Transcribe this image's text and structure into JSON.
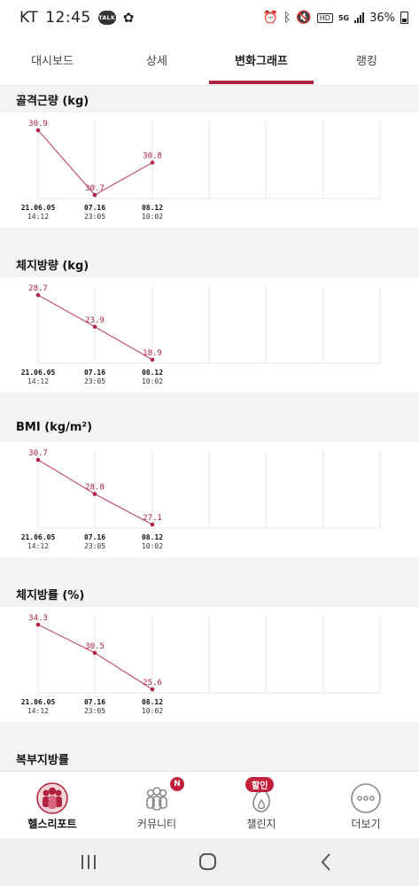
{
  "status_bar": {
    "carrier": "KT",
    "time": "12:45",
    "talk": "TALK",
    "network": "5G",
    "battery": "36%"
  },
  "tabs": [
    {
      "label": "대시보드"
    },
    {
      "label": "상세"
    },
    {
      "label": "변화그래프"
    },
    {
      "label": "랭킹"
    }
  ],
  "active_tab_index": 2,
  "chart_data": [
    {
      "type": "line",
      "title": "골격근량 (kg)",
      "x": [
        "21.06.05 14:12",
        "07.16 23:05",
        "08.12 10:02"
      ],
      "series": [
        {
          "values": [
            30.9,
            30.7,
            30.8
          ]
        }
      ],
      "grid": true
    },
    {
      "type": "line",
      "title": "체지방량 (kg)",
      "x": [
        "21.06.05 14:12",
        "07.16 23:05",
        "08.12 10:02"
      ],
      "series": [
        {
          "values": [
            28.7,
            23.9,
            18.9
          ]
        }
      ],
      "grid": true
    },
    {
      "type": "line",
      "title": "BMI (kg/m²)",
      "x": [
        "21.06.05 14:12",
        "07.16 23:05",
        "08.12 10:02"
      ],
      "series": [
        {
          "values": [
            30.7,
            28.8,
            27.1
          ]
        }
      ],
      "grid": true
    },
    {
      "type": "line",
      "title": "체지방률 (%)",
      "x": [
        "21.06.05 14:12",
        "07.16 23:05",
        "08.12 10:02"
      ],
      "series": [
        {
          "values": [
            34.3,
            30.5,
            25.6
          ]
        }
      ],
      "grid": true
    }
  ],
  "x_labels": [
    {
      "date": "21.06.05",
      "time": "14:12"
    },
    {
      "date": "07.16",
      "time": "23:05"
    },
    {
      "date": "08.12",
      "time": "10:02"
    }
  ],
  "next_section_title": "복부지방률",
  "bottom_nav": [
    {
      "label": "헬스리포트",
      "icon": "people-icon"
    },
    {
      "label": "커뮤니티",
      "icon": "community-icon",
      "badge": "N"
    },
    {
      "label": "챌린지",
      "icon": "fire-icon",
      "badge": "할인"
    },
    {
      "label": "더보기",
      "icon": "more-icon"
    }
  ],
  "colors": {
    "accent": "#b0223d",
    "line": "#c0506a",
    "grid": "#e4e4e4",
    "bg": "#f3f3f3"
  }
}
